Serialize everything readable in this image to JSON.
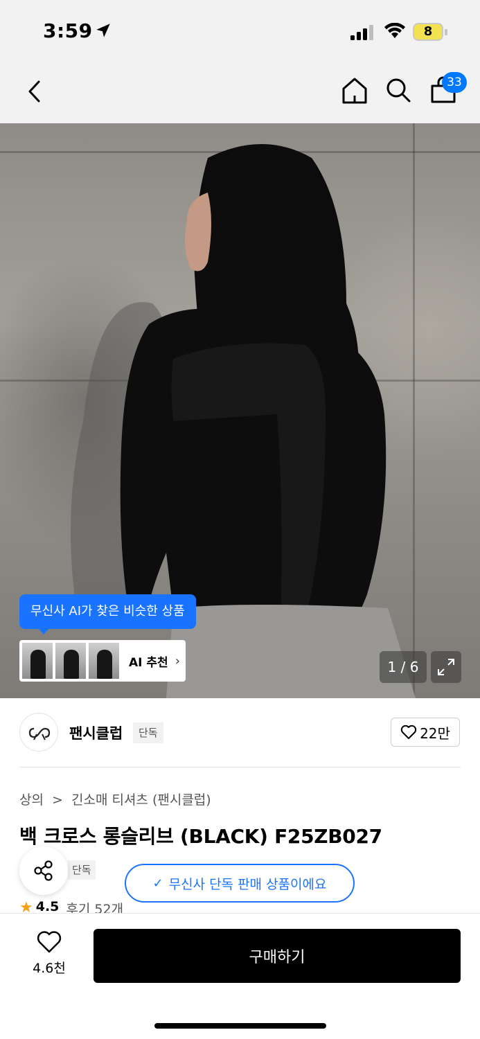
{
  "status_bar": {
    "time": "3:59",
    "battery": "8"
  },
  "nav": {
    "cart_count": "33"
  },
  "hero": {
    "ai_tooltip": "무신사 AI가 찾은 비슷한 상품",
    "ai_recommend_label": "AI 추천",
    "page_indicator": "1 / 6"
  },
  "brand": {
    "name": "팬시클럽",
    "tag": "단독",
    "like_count": "22만"
  },
  "breadcrumb": {
    "category": "상의",
    "separator": ">",
    "subcategory": "긴소매 티셔츠 (팬시클럽)"
  },
  "product": {
    "title": "백 크로스 롱슬리브 (BLACK) F25ZB027",
    "exclusive_tag": "단독",
    "exclusive_notice": "무신사 단독 판매 상품이에요",
    "rating": "4.5",
    "reviews": "후기 52개"
  },
  "bottom_bar": {
    "wish_count": "4.6천",
    "buy_label": "구매하기"
  },
  "colors": {
    "accent": "#1a73ff",
    "badge": "#0078ff",
    "star": "#f2a01b",
    "buy_button": "#000000"
  }
}
